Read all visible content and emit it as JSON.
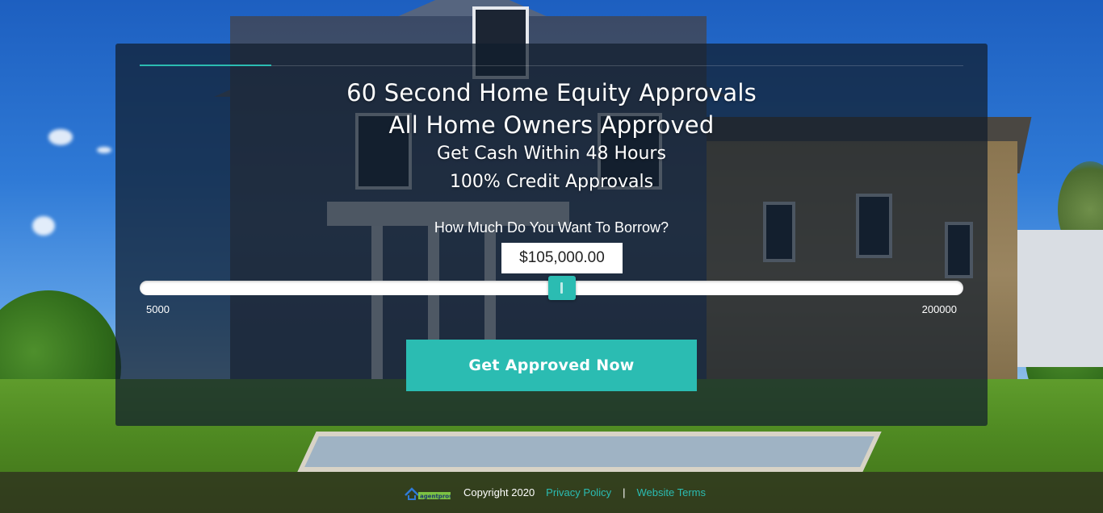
{
  "headline": {
    "line1": "60 Second Home Equity Approvals",
    "line2": "All Home Owners Approved",
    "line3": "Get Cash Within 48 Hours",
    "line4": "100% Credit Approvals"
  },
  "borrow": {
    "label": "How Much Do You Want To Borrow?",
    "amount": "$105,000.00",
    "slider_min": "5000",
    "slider_max": "200000",
    "slider_value": 105000
  },
  "cta": {
    "label": "Get Approved Now"
  },
  "footer": {
    "logo_text": "agentpros",
    "copyright": "Copyright 2020",
    "privacy_link": "Privacy Policy",
    "separator": "|",
    "terms_link": "Website Terms"
  },
  "colors": {
    "accent": "#2bbcb2",
    "card_bg": "rgba(17,29,45,0.72)",
    "text": "#ffffff"
  }
}
